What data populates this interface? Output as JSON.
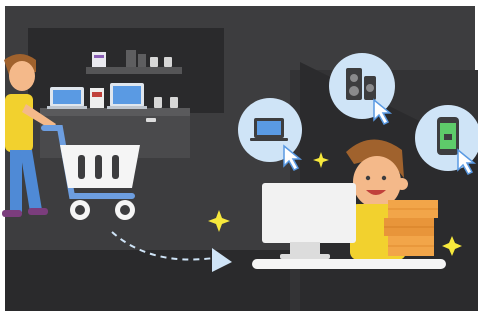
{
  "scene": {
    "description_icons": [
      "laptop-icon",
      "speaker-icon",
      "smartphone-icon",
      "cursor-icon",
      "sparkle-icon",
      "shopping-cart-icon"
    ],
    "colors": {
      "background": "#3d3d3f",
      "background_dark": "#262628",
      "shelf": "#4a4a4c",
      "bubble": "#cfe4f7",
      "skin": "#f4b98a",
      "hair": "#a0622d",
      "shirt_yellow": "#f2d12e",
      "pants_blue": "#4f8ad6",
      "cart_blue": "#6d9ee0",
      "boxes_orange": "#f2a549",
      "monitor_white": "#f2f2f2",
      "sparkle": "#f7e93c"
    }
  }
}
